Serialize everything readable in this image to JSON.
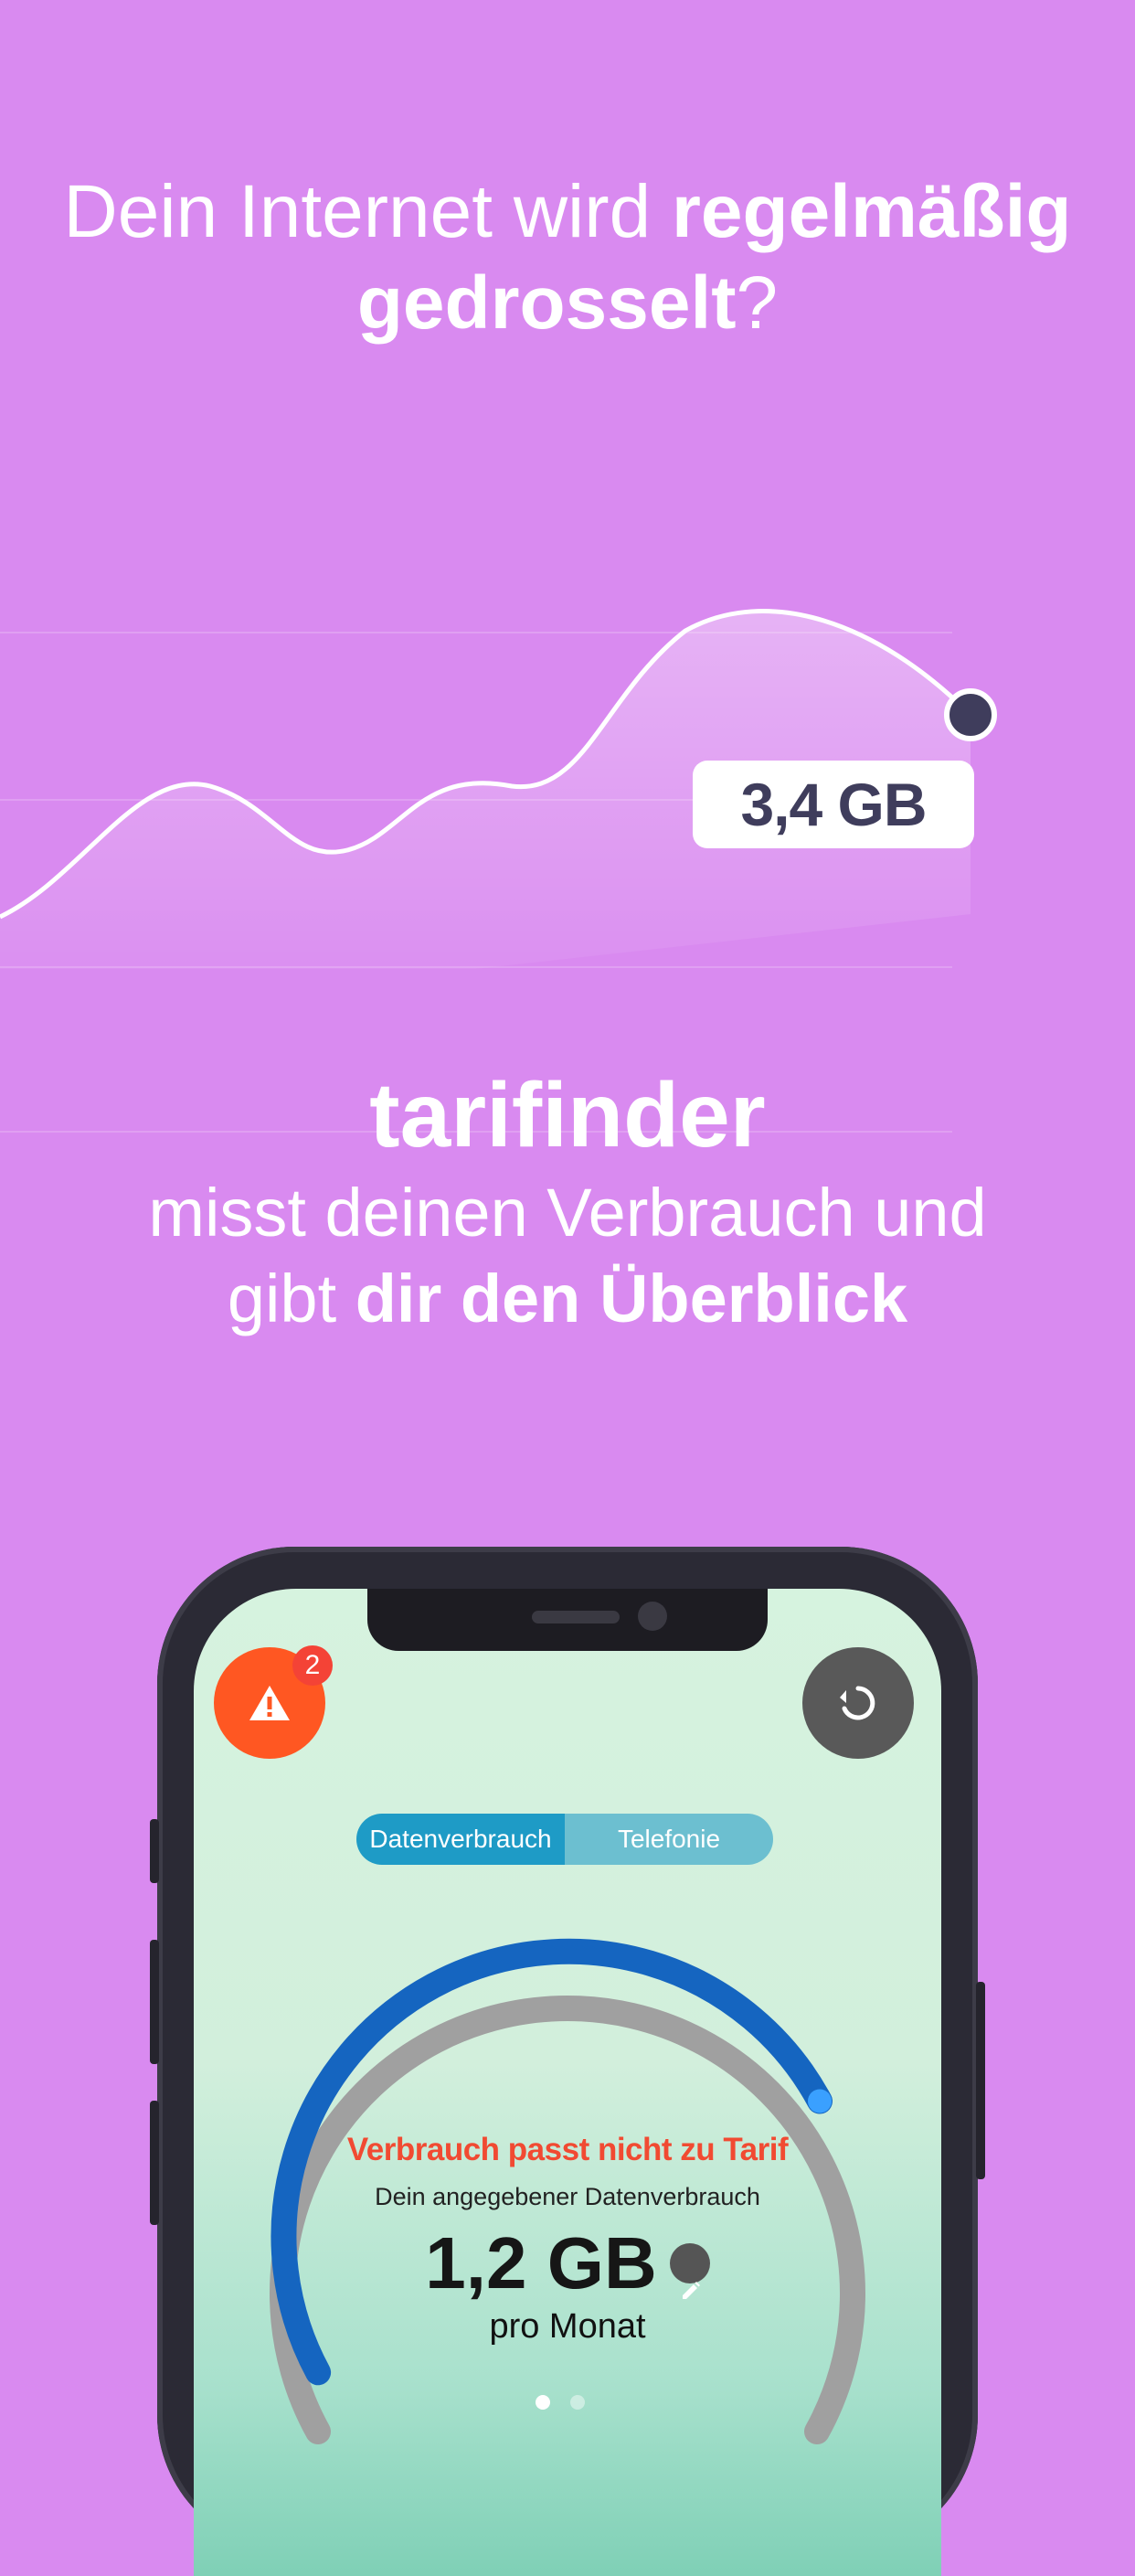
{
  "headline": {
    "part1": "Dein Internet wird ",
    "bold1": "regelmäßig",
    "bold2": "gedrosselt",
    "part2": "?"
  },
  "chart_data": {
    "type": "area",
    "label": "3,4 GB"
  },
  "brand": {
    "name": "tarifinder",
    "line1": "misst deinen Verbrauch und",
    "line2_normal": "gibt ",
    "line2_bold": "dir den Überblick"
  },
  "app": {
    "alert_badge_count": "2",
    "tabs": [
      {
        "label": "Datenverbrauch",
        "active": true
      },
      {
        "label": "Telefonie",
        "active": false
      }
    ],
    "gauge": {
      "warning": "Verbrauch passt nicht zu Tarif",
      "description": "Dein angegebener Datenverbrauch",
      "amount": "1,2 GB",
      "unit": "pro Monat",
      "fill_fraction": 0.6
    },
    "page_indicator": {
      "current": 1,
      "total": 2
    }
  },
  "colors": {
    "background": "#d98af0",
    "alert": "#ff5722",
    "tab_active": "#1e9bc6",
    "gauge_fill": "#1565c0",
    "gauge_track": "#a0a0a0",
    "warning_text": "#f14a32"
  },
  "icons": {
    "alert": "warning-triangle-icon",
    "refresh": "refresh-icon",
    "edit": "pencil-icon"
  }
}
